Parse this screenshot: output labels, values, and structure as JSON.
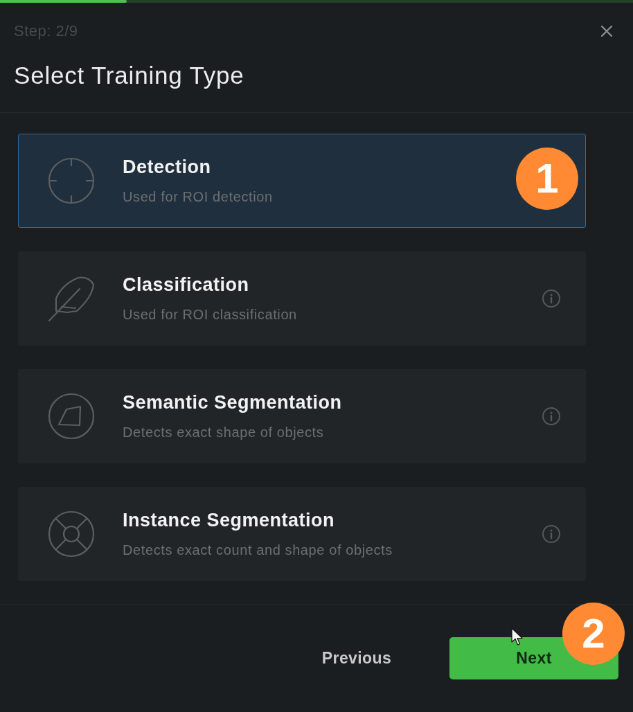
{
  "progress": {
    "level": 0.2
  },
  "header": {
    "step": "Step: 2/9",
    "title": "Select Training Type"
  },
  "options": [
    {
      "kind": "target",
      "title": "Detection",
      "description": "Used for ROI detection",
      "selected": true,
      "marker": "1"
    },
    {
      "kind": "feather",
      "title": "Classification",
      "description": "Used for ROI classification",
      "selected": false,
      "info": true
    },
    {
      "kind": "shape",
      "title": "Semantic Segmentation",
      "description": "Detects exact shape of objects",
      "selected": false,
      "info": true
    },
    {
      "kind": "ring",
      "title": "Instance Segmentation",
      "description": "Detects exact count and shape of objects",
      "selected": false,
      "info": true
    }
  ],
  "buttons": [
    {
      "kind": "secondary",
      "label": "Previous"
    },
    {
      "kind": "primary",
      "label": "Next",
      "marker": "2"
    }
  ]
}
